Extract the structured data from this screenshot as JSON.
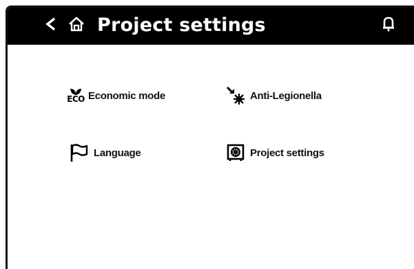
{
  "header": {
    "title": "Project settings",
    "back_icon": "chevron-left-icon",
    "home_icon": "home-icon",
    "notification_icon": "bell-icon",
    "background": "#000000",
    "text_color": "#ffffff"
  },
  "menu": {
    "items": [
      {
        "label": "Economic mode",
        "icon": "eco-icon",
        "icon_text": "ECO"
      },
      {
        "label": "Anti-Legionella",
        "icon": "anti-legionella-icon"
      },
      {
        "label": "Language",
        "icon": "flag-icon"
      },
      {
        "label": "Project settings",
        "icon": "safe-icon"
      }
    ]
  }
}
